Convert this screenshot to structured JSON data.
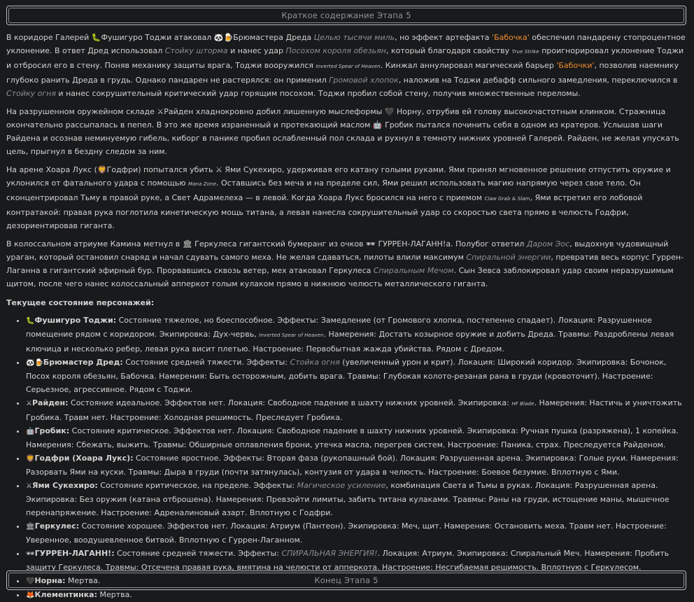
{
  "header": {
    "title": "Краткое содержание Этапа 5"
  },
  "footer": {
    "title": "Конец Этапа 5"
  },
  "paragraphs": {
    "p1": {
      "a": "В коридоре Галерей 🐛",
      "n1": "Фушигуро Тоджи",
      "b": " атаковал 🐼🍺",
      "n2": "Брюмастера Дреда",
      "s1": "Целью тысячи миль",
      "c": ", но эффект артефакта ",
      "art1": "'Бабочка'",
      "d": " обеспечил пандарену стопроцентное уклонение. В ответ Дред использовал ",
      "s2": "Стойку шторма",
      "e": " и нанес удар ",
      "s3": "Посохом короля обезьян",
      "f": ", который благодаря свойству ",
      "tiny1": "True Strike",
      "g": " проигнорировал уклонение Тоджи и отбросил его в стену. Поняв механику защиты врага, Тоджи вооружился ",
      "tiny2": "Inverted Spear of Heaven",
      "h": ". Кинжал аннулировал магический барьер ",
      "art2": "'Бабочки'",
      "i": ", позволив наемнику глубоко ранить Дреда в грудь. Однако пандарен не растерялся: он применил ",
      "s4": "Громовой хлопок",
      "j": ", наложив на Тоджи дебафф сильного замедления, переключился в ",
      "s5": "Стойку огня",
      "k": " и нанес сокрушительный критический удар горящим посохом. Тоджи пробил собой стену, получив множественные переломы."
    },
    "p2": "На разрушенном оружейном складе ⚔Райден хладнокровно добил лишенную мыслеформы 🖤 Норну, отрубив ей голову высокочастотным клинком. Стражница окончательно рассыпалась в пепел. В это же время израненный и протекающий маслом 🤖 Гробик пытался починить себя в одном из кратеров. Услышав шаги Райдена и осознав неминуемую гибель, киборг в панике пробил ослабленный пол склада и рухнул в темноту нижних уровней Галерей. Райден, не желая упускать цель, прыгнул в бездну следом за ним.",
    "p3": {
      "a": "На арене Хоара Лукс (🦁Годфри) попытался убить ⚔ Ями Сукехиро, удерживая его катану голыми руками. Ями принял мгновенное решение отпустить оружие и уклонился от фатального удара с помощью ",
      "tiny1": "Mana Zone",
      "b": ". Оставшись без меча и на пределе сил, Ями решил использовать магию напрямую через свое тело. Он сконцентрировал Тьму в правой руке, а Свет Адрамелеха — в левой. Когда Хоара Лукс бросился на него с приемом ",
      "tiny2": "Claw Grab & Slam",
      "c": ", Ями встретил его лобовой контратакой: правая рука поглотила кинетическую мощь титана, а левая нанесла сокрушительный удар со скоростью света прямо в челюсть Годфри, дезориентировав гиганта."
    },
    "p4": {
      "a": "В колоссальном атриуме Камина метнул в 🏛 Геркулеса гигантский бумеранг из очков 🕶 ГУРРЕН-ЛАГАНН!a. Полубог ответил ",
      "s1": "Даром Эос",
      "b": ", выдохнув чудовищный ураган, который остановил снаряд и начал сдувать самого меха. Не желая сдаваться, пилоты влили максимум ",
      "s2": "Спиральной энергии",
      "c": ", превратив весь корпус Гуррен-Лаганна в гигантский эфирный бур. Прорвавшись сквозь ветер, мех атаковал Геркулеса ",
      "s3": "Спиральным Мечом",
      "d": ". Сын Зевса заблокировал удар своим неразрушимым щитом, после чего нанес колоссальный апперкот голым кулаком прямо в нижнюю челюсть металлического гиганта."
    }
  },
  "status_header": "Текущее состояние персонажей:",
  "characters": [
    {
      "icon": "🐛",
      "name": "Фушигуро Тоджи:",
      "a": " Состояние тяжелое, но боеспособное. Эффекты: Замедление (от Громового хлопка, постепенно спадает). Локация: Разрушенное помещение рядом с коридором. Экипировка: Дух-червь, ",
      "tiny": "Inverted Spear of Heaven",
      "b": ". Намерения: Достать козырное оружие и добить Дреда. Травмы: Раздроблены левая ключица и несколько ребер, левая рука висит плетью. Настроение: Первобытная жажда убийства. Рядом с Дредом."
    },
    {
      "icon": "🐼🍺",
      "name": "Брюмастер Дред:",
      "a": " Состояние средней тяжести. Эффекты: ",
      "skill": "Стойка огня",
      "b": " (увеличенный урон и крит). Локация: Широкий коридор. Экипировка: Бочонок, Посох короля обезьян, Бабочка. Намерения: Быть осторожным, добить врага. Травмы: Глубокая колото-резаная рана в груди (кровоточит). Настроение: Серьезное, агрессивное. Рядом с Тоджи."
    },
    {
      "icon": "⚔",
      "name": "Райден:",
      "a": " Состояние идеальное. Эффектов нет. Локация: Свободное падение в шахту нижних уровней. Экипировка: ",
      "tiny": "HF Blade",
      "b": ". Намерения: Настичь и уничтожить Гробика. Травм нет. Настроение: Холодная решимость. Преследует Гробика."
    },
    {
      "icon": "🤖",
      "name": "Гробик:",
      "a": " Состояние критическое. Эффектов нет. Локация: Свободное падение в шахту нижних уровней. Экипировка: Ручная пушка (разряжена), 1 копейка. Намерения: Сбежать, выжить. Травмы: Обширные оплавления брони, утечка масла, перегрев систем. Настроение: Паника, страх. Преследуется Райденом."
    },
    {
      "icon": "🦁",
      "name": "Годфри (Хоара Лукс):",
      "a": " Состояние яростное. Эффекты: Вторая фаза (рукопашный бой). Локация: Разрушенная арена. Экипировка: Голые руки. Намерения: Разорвать Ями на куски. Травмы: Дыра в груди (почти затянулась), контузия от удара в челюсть. Настроение: Боевое безумие. Вплотную с Ями."
    },
    {
      "icon": "⚔",
      "name": "Ями Сукехиро:",
      "a": " Состояние критическое, на пределе. Эффекты: ",
      "skill": "Магическое усиление",
      "b": ", комбинация Света и Тьмы в руках. Локация: Разрушенная арена. Экипировка: Без оружия (катана отброшена). Намерения: Превзойти лимиты, забить титана кулаками. Травмы: Раны на груди, истощение маны, мышечное перенапряжение. Настроение: Адреналиновый азарт. Вплотную с Годфри."
    },
    {
      "icon": "🏛",
      "name": "Геркулес:",
      "a": " Состояние хорошее. Эффектов нет. Локация: Атриум (Пантеон). Экипировка: Меч, щит. Намерения: Остановить меха. Травм нет. Настроение: Уверенное, воодушевленное битвой. Вплотную с Гуррен-Лаганном."
    },
    {
      "icon": "🕶",
      "name": "ГУРРЕН-ЛАГАНН!:",
      "a": " Состояние средней тяжести. Эффекты: ",
      "skill": "СПИРАЛЬНАЯ ЭНЕРГИЯ!",
      "b": ". Локация: Атриум. Экипировка: Спиральный Меч. Намерения: Пробить защиту Геркулеса. Травмы: Отсечена правая рука, вмятина на челюсти от апперкота. Настроение: Несгибаемая решимость. Вплотную с Геркулесом."
    },
    {
      "icon": "🖤",
      "name": "Норна:",
      "a": " Мертва."
    },
    {
      "icon": "🦊",
      "name": "Клементинка:",
      "a": " Мертва."
    }
  ]
}
